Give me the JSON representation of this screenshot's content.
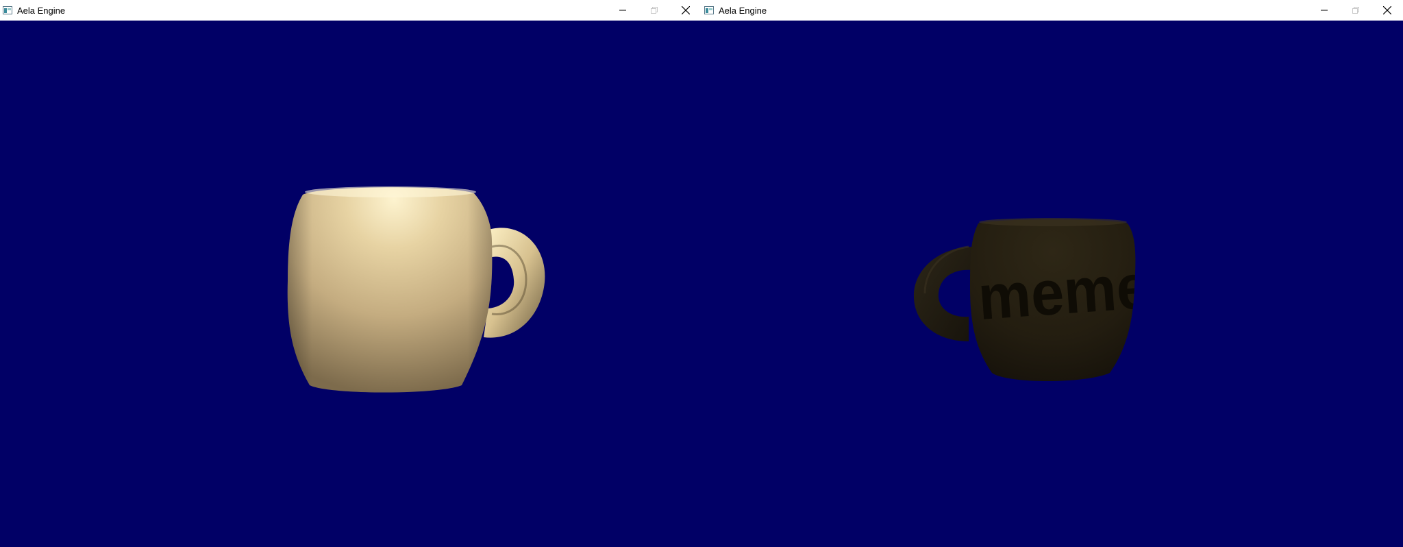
{
  "windows": [
    {
      "title": "Aela Engine",
      "controls": {
        "minimize_icon": "minimize-icon",
        "maximize_icon": "maximize-icon",
        "close_icon": "close-icon"
      },
      "viewport": {
        "background_color": "#010066",
        "object": "lit-mug"
      }
    },
    {
      "title": "Aela Engine",
      "controls": {
        "minimize_icon": "minimize-icon",
        "maximize_icon": "maximize-icon",
        "close_icon": "close-icon"
      },
      "viewport": {
        "background_color": "#010066",
        "object": "dark-mug",
        "mug_text": "meme"
      }
    }
  ]
}
